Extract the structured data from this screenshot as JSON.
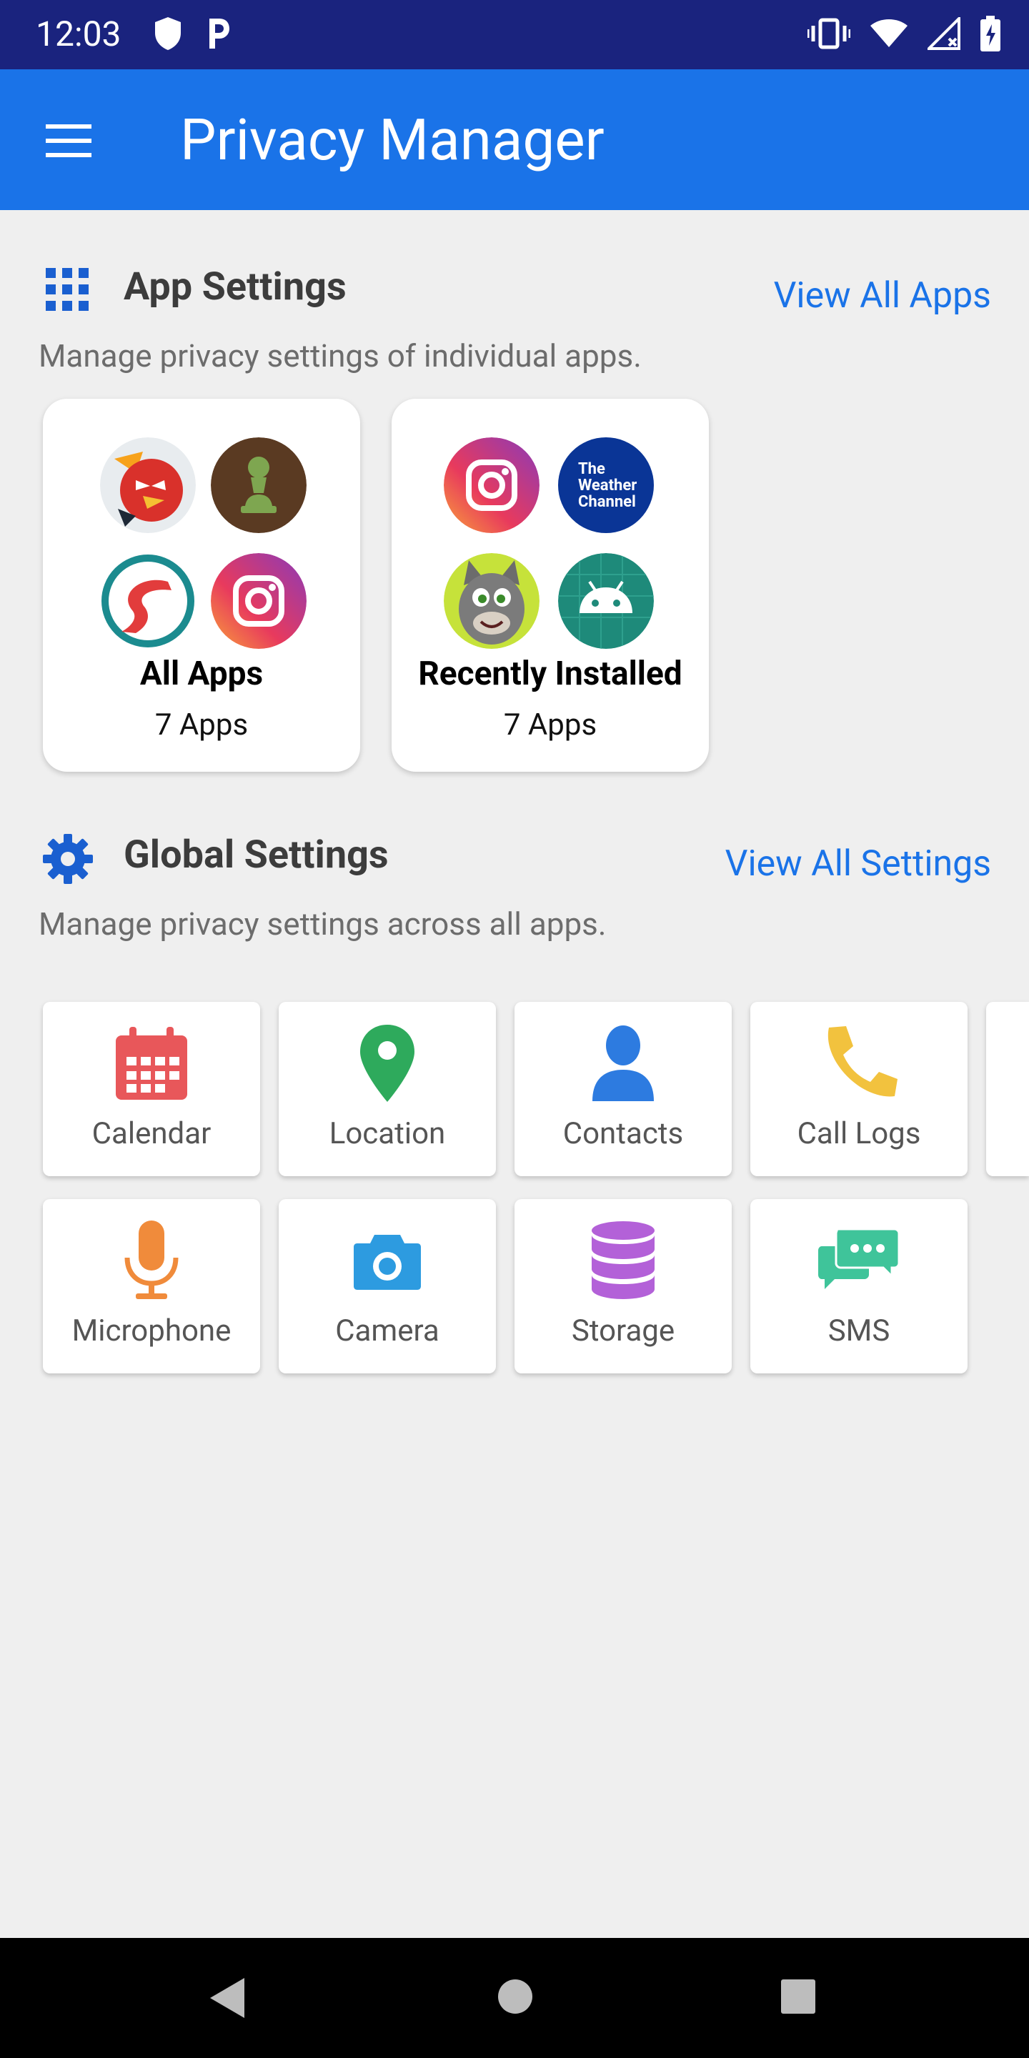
{
  "status_bar": {
    "time": "12:03",
    "left_icons": [
      "shield-icon",
      "parking-icon"
    ],
    "right_icons": [
      "vibrate-icon",
      "wifi-icon",
      "signal-icon",
      "battery-charging-icon"
    ],
    "background": "#1a237e"
  },
  "app_bar": {
    "title": "Privacy Manager",
    "menu_icon": "menu-icon",
    "background": "#1a73e8"
  },
  "app_settings": {
    "icon": "grid-icon",
    "title": "App Settings",
    "view_all": "View All Apps",
    "description": "Manage privacy settings of individual apps.",
    "cards": [
      {
        "title": "All Apps",
        "count": "7 Apps",
        "icons": [
          "angry-birds-icon",
          "chess-icon",
          "road-app-icon",
          "instagram-icon"
        ]
      },
      {
        "title": "Recently Installed",
        "count": "7 Apps",
        "icons": [
          "instagram-icon",
          "weather-channel-icon",
          "talking-tom-icon",
          "android-icon"
        ],
        "weather_logo_text": "The Weather Channel"
      }
    ]
  },
  "global_settings": {
    "icon": "gear-icon",
    "title": "Global Settings",
    "view_all": "View All Settings",
    "description": "Manage privacy settings across all apps.",
    "tiles": [
      {
        "label": "Calendar",
        "icon": "calendar-icon",
        "color": "#e8575a"
      },
      {
        "label": "Location",
        "icon": "location-pin-icon",
        "color": "#2eaa5c"
      },
      {
        "label": "Contacts",
        "icon": "person-icon",
        "color": "#2d7be0"
      },
      {
        "label": "Call Logs",
        "icon": "phone-icon",
        "color": "#f2c23e"
      },
      {
        "label": "Microphone",
        "icon": "microphone-icon",
        "color": "#f08b3b"
      },
      {
        "label": "Camera",
        "icon": "camera-icon",
        "color": "#2d9be0"
      },
      {
        "label": "Storage",
        "icon": "database-icon",
        "color": "#b361d8"
      },
      {
        "label": "SMS",
        "icon": "sms-icon",
        "color": "#3fc49a"
      }
    ]
  },
  "nav_bar": {
    "buttons": [
      "back-icon",
      "home-icon",
      "recents-icon"
    ]
  }
}
